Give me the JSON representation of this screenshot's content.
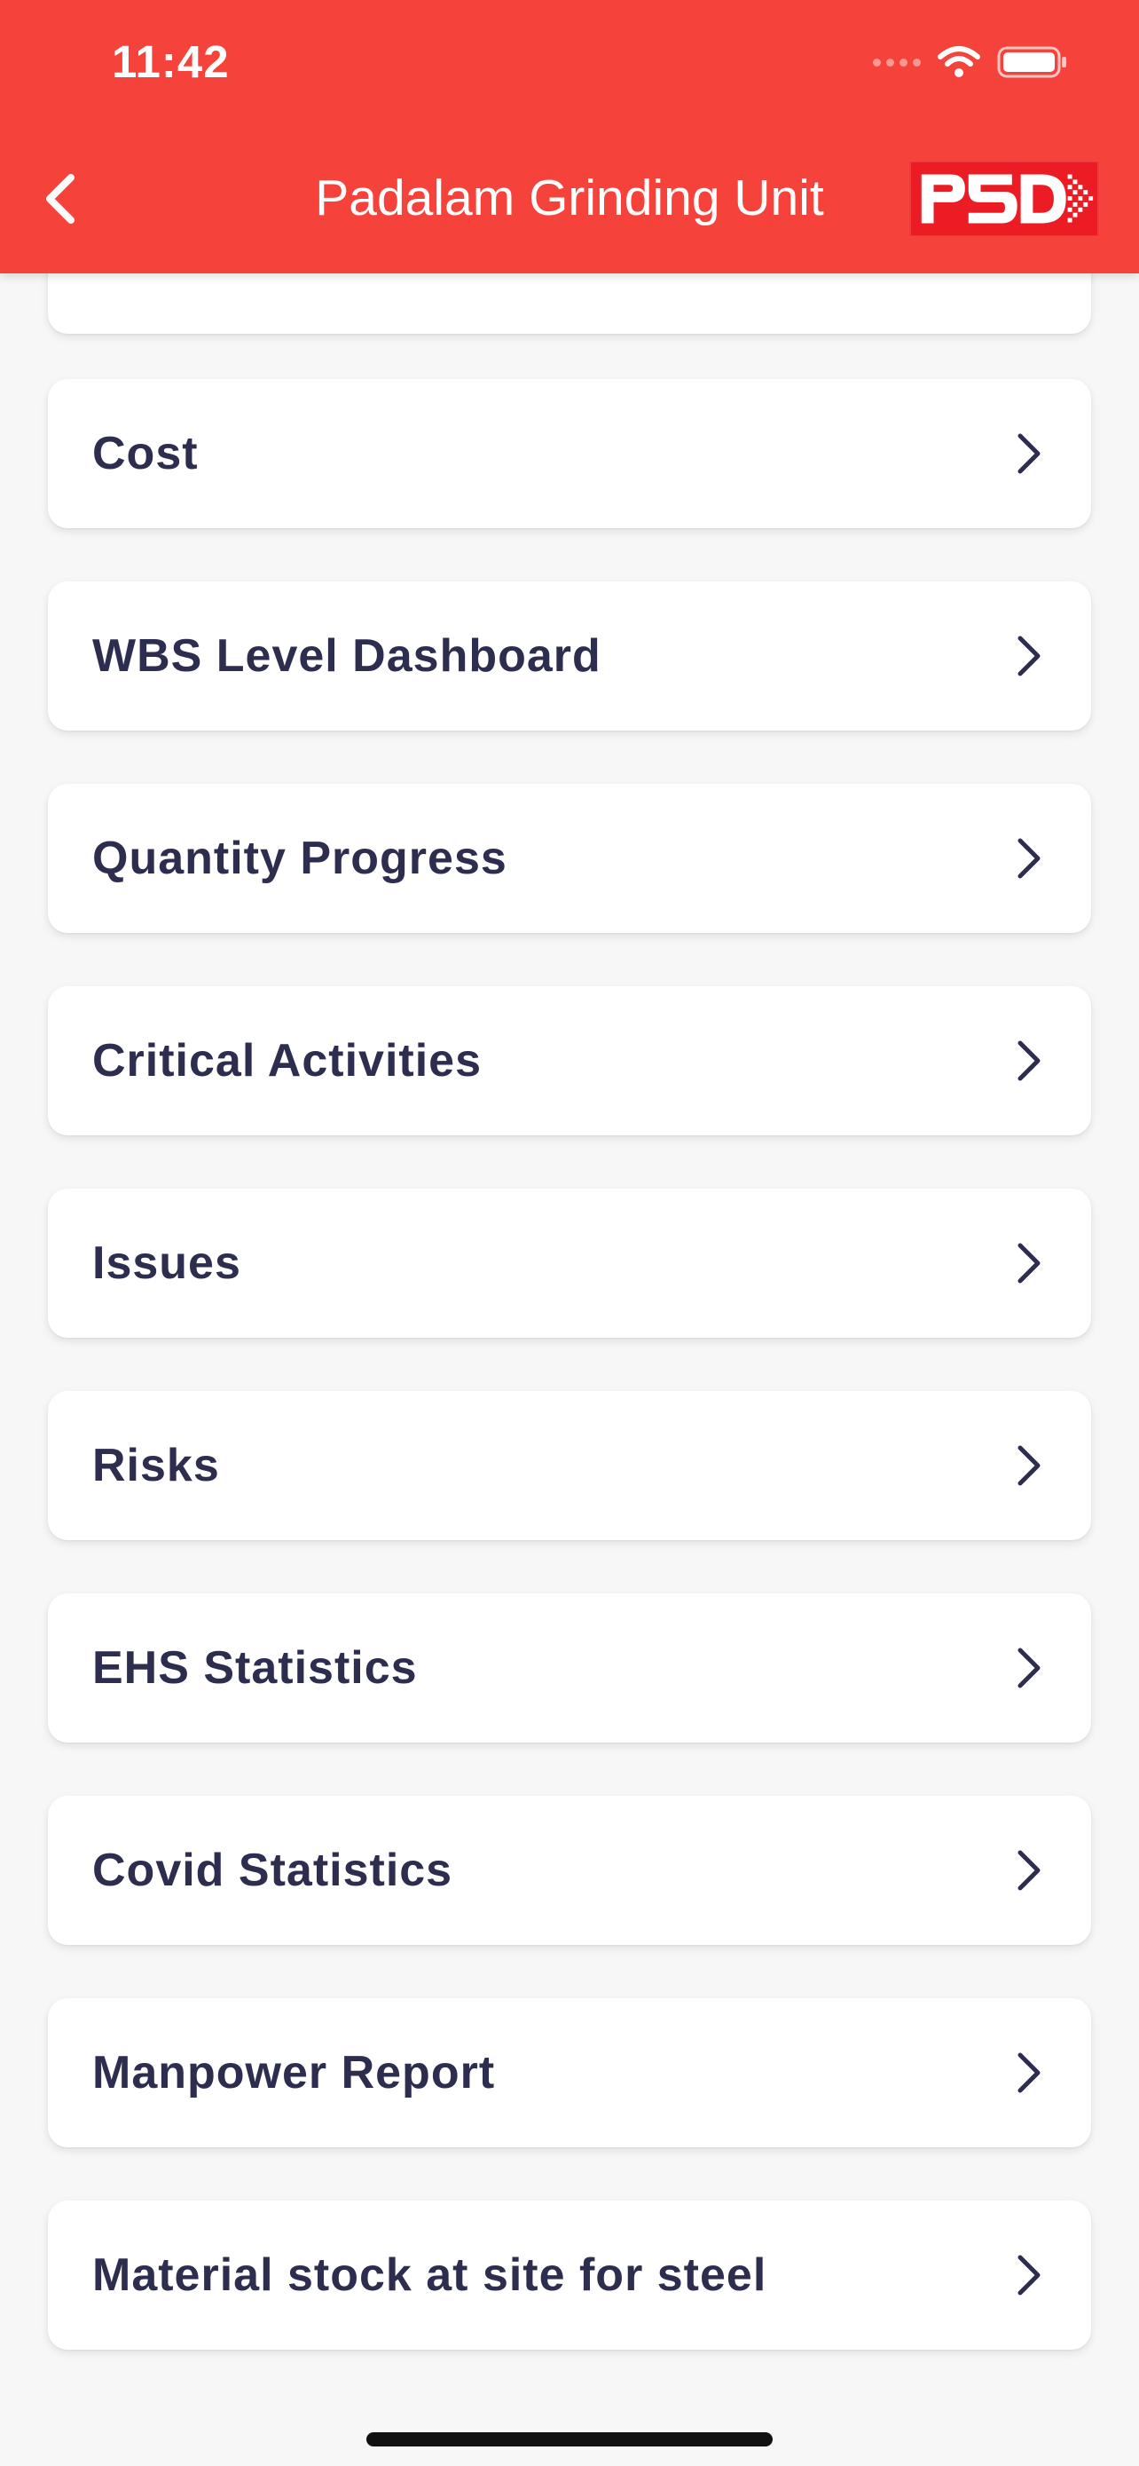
{
  "status_bar": {
    "time": "11:42"
  },
  "header": {
    "title": "Padalam Grinding Unit",
    "logo_text": "PSD",
    "bg_color": "#f5423a",
    "back_icon": "chevron-left-icon"
  },
  "menu": {
    "items": [
      {
        "label": "Cost"
      },
      {
        "label": "WBS Level Dashboard"
      },
      {
        "label": "Quantity Progress"
      },
      {
        "label": "Critical Activities"
      },
      {
        "label": "Issues"
      },
      {
        "label": "Risks"
      },
      {
        "label": "EHS Statistics"
      },
      {
        "label": "Covid Statistics"
      },
      {
        "label": "Manpower Report"
      },
      {
        "label": "Material stock at site for steel"
      }
    ],
    "item_icon": "chevron-right-icon",
    "text_color": "#2d2d4f"
  }
}
